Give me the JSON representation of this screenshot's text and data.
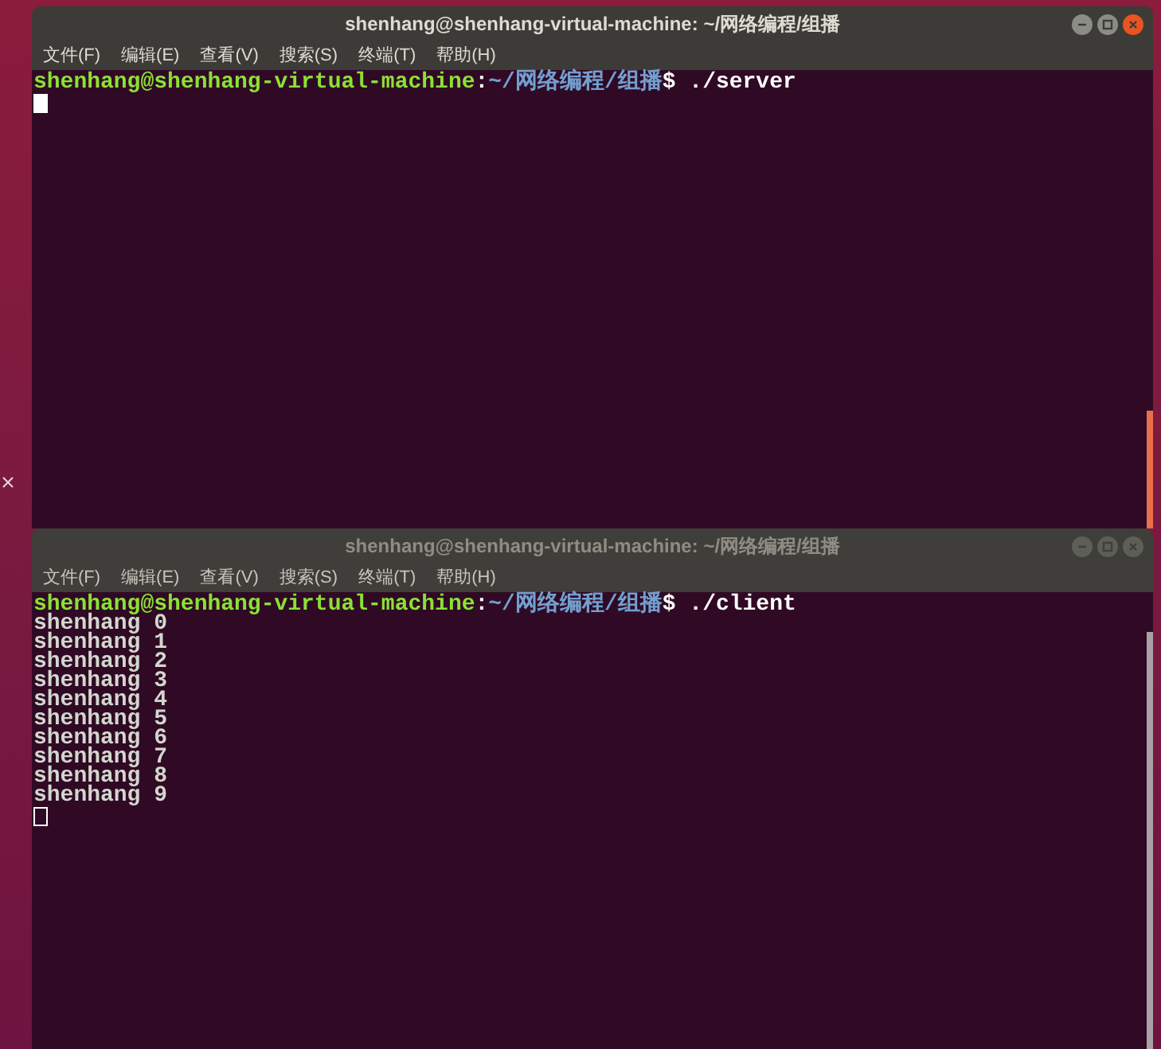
{
  "windows": [
    {
      "title": "shenhang@shenhang-virtual-machine: ~/网络编程/组播",
      "active": true,
      "menu": [
        "文件(F)",
        "编辑(E)",
        "查看(V)",
        "搜索(S)",
        "终端(T)",
        "帮助(H)"
      ],
      "prompt": {
        "user_host": "shenhang@shenhang-virtual-machine",
        "colon": ":",
        "path": "~/网络编程/组播",
        "dollar": "$",
        "command": " ./server"
      }
    },
    {
      "title": "shenhang@shenhang-virtual-machine: ~/网络编程/组播",
      "active": false,
      "menu": [
        "文件(F)",
        "编辑(E)",
        "查看(V)",
        "搜索(S)",
        "终端(T)",
        "帮助(H)"
      ],
      "prompt": {
        "user_host": "shenhang@shenhang-virtual-machine",
        "colon": ":",
        "path": "~/网络编程/组播",
        "dollar": "$",
        "command": " ./client"
      },
      "output": [
        "shenhang 0",
        "shenhang 1",
        "shenhang 2",
        "shenhang 3",
        "shenhang 4",
        "shenhang 5",
        "shenhang 6",
        "shenhang 7",
        "shenhang 8",
        "shenhang 9"
      ]
    }
  ]
}
